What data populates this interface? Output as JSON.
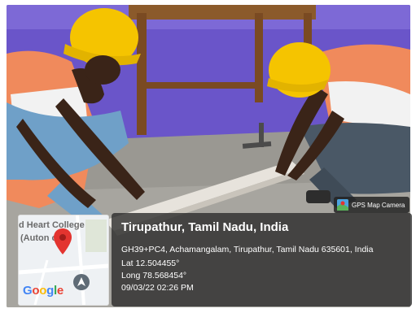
{
  "badge": {
    "label": "GPS Map Camera",
    "icon": "gps-map-camera-icon"
  },
  "location": {
    "place": "Tirupathur, Tamil Nadu, India",
    "address": "GH39+PC4, Achamangalam, Tirupathur, Tamil Nadu 635601, India",
    "lat": "Lat 12.504455°",
    "long": "Long 78.568454°",
    "datetime": "09/03/22 02:26 PM"
  },
  "map": {
    "label_top": "d Heart College",
    "label_bottom": "(Auton    ous)",
    "logo": "Google",
    "pin": "map-pin-icon",
    "nav": "navigation-icon"
  },
  "colors": {
    "overlay": "#2b2b2b",
    "pin": "#e3342f",
    "wall": "#6a55c9",
    "helmet": "#f5c400"
  }
}
